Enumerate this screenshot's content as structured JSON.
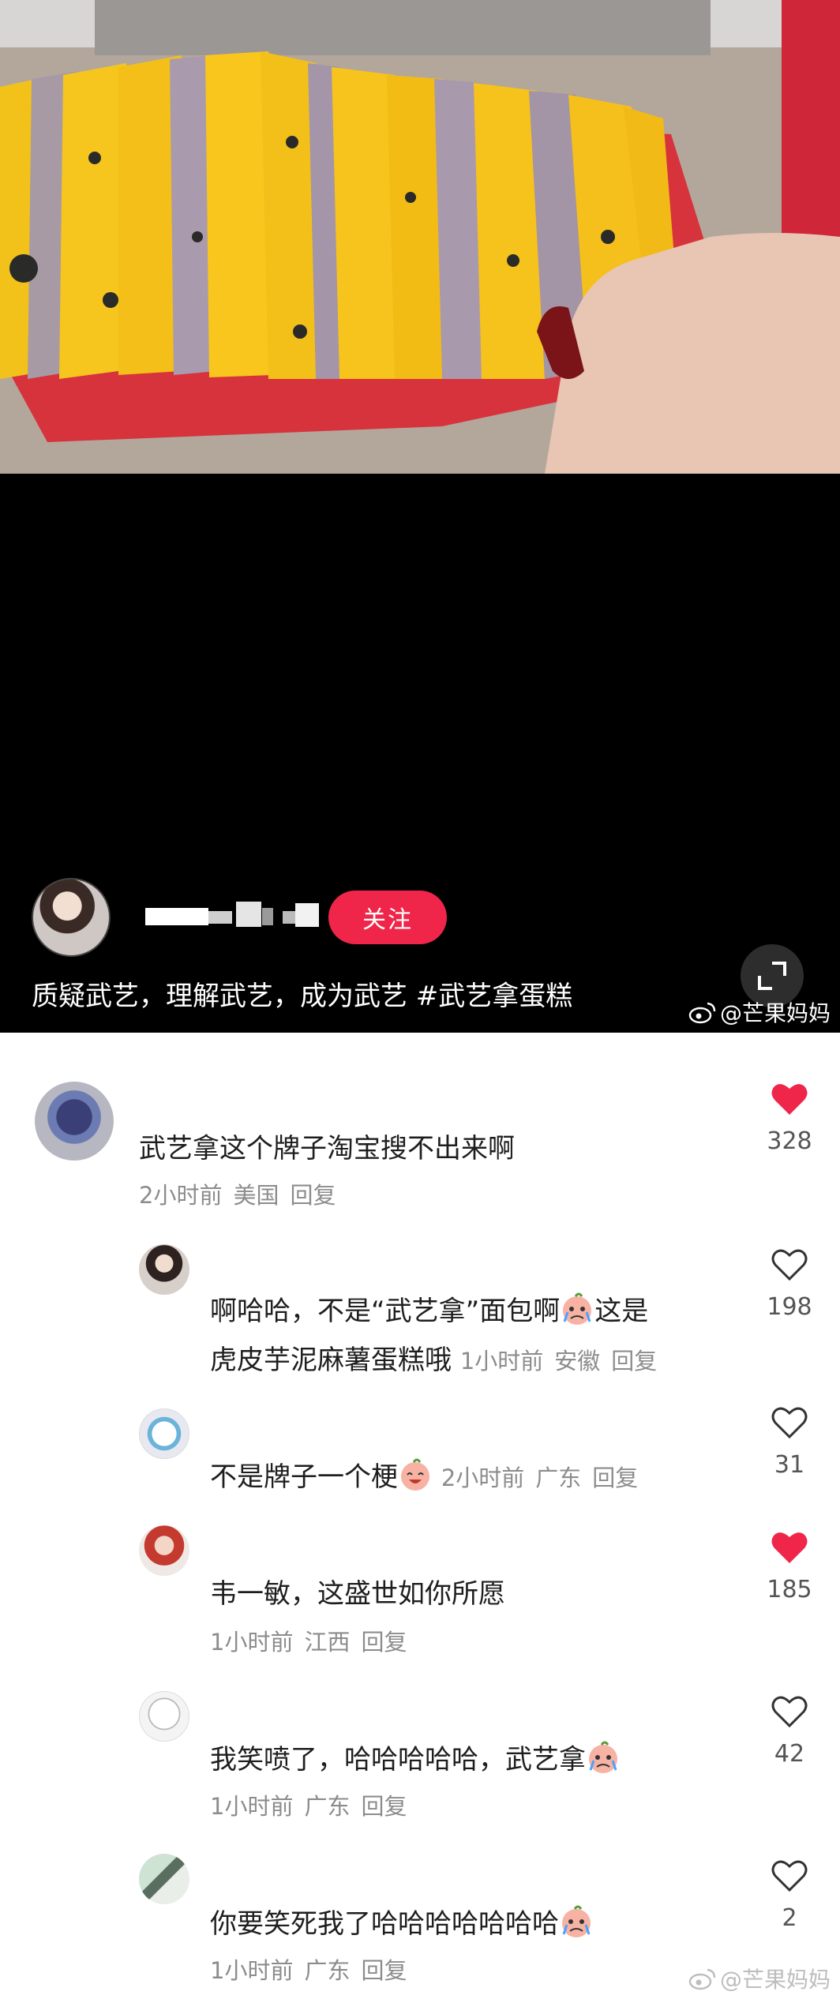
{
  "video": {
    "follow_label": "关注",
    "caption": "质疑武艺，理解武艺，成为武艺 #武艺拿蛋糕"
  },
  "watermark": {
    "top_text": "@芒果妈妈",
    "bottom_text": "@芒果妈妈"
  },
  "comments": [
    {
      "text": "武艺拿这个牌子淘宝搜不出来啊",
      "time": "2小时前",
      "location": "美国",
      "reply": "回复",
      "likes": "328",
      "liked": true
    },
    {
      "text_line1": "啊哈哈，不是“武艺拿”面包啊",
      "text_line1_tail": "这是",
      "text_line2": "虎皮芋泥麻薯蛋糕哦",
      "time": "1小时前",
      "location": "安徽",
      "reply": "回复",
      "likes": "198",
      "liked": false
    },
    {
      "text": "不是牌子一个梗",
      "time": "2小时前",
      "location": "广东",
      "reply": "回复",
      "likes": "31",
      "liked": false
    },
    {
      "text": "韦一敏，这盛世如你所愿",
      "time": "1小时前",
      "location": "江西",
      "reply": "回复",
      "likes": "185",
      "liked": true
    },
    {
      "text": "我笑喷了，哈哈哈哈哈，武艺拿",
      "time": "1小时前",
      "location": "广东",
      "reply": "回复",
      "likes": "42",
      "liked": false
    },
    {
      "text": "你要笑死我了哈哈哈哈哈哈哈",
      "time": "1小时前",
      "location": "广东",
      "reply": "回复",
      "likes": "2",
      "liked": false
    }
  ],
  "colors": {
    "accent": "#f0254a",
    "liked_heart": "#f0254a",
    "meta_text": "#8c8c8c"
  }
}
